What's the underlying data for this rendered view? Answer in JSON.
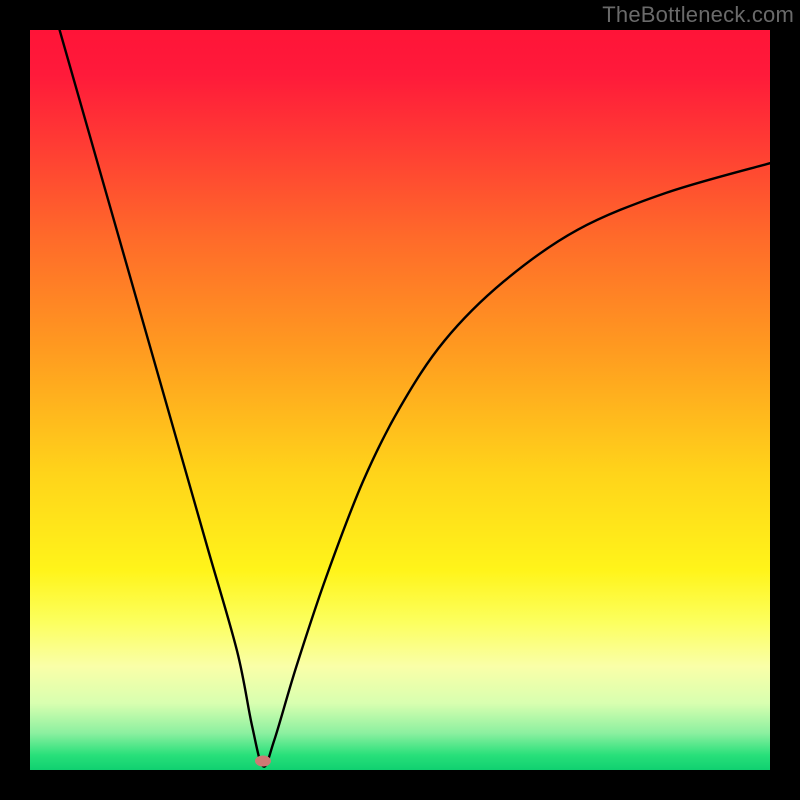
{
  "watermark": "TheBottleneck.com",
  "chart_data": {
    "type": "line",
    "title": "",
    "xlabel": "",
    "ylabel": "",
    "xlim": [
      0,
      100
    ],
    "ylim": [
      0,
      100
    ],
    "background": "rainbow-gradient-vertical",
    "series": [
      {
        "name": "bottleneck-curve",
        "x": [
          4,
          8,
          12,
          16,
          20,
          24,
          28,
          30,
          31.5,
          33,
          36,
          40,
          45,
          50,
          56,
          64,
          74,
          86,
          100
        ],
        "y": [
          100,
          86,
          72,
          58,
          44,
          30,
          16,
          6,
          0.5,
          4,
          14,
          26,
          39,
          49,
          58,
          66,
          73,
          78,
          82
        ]
      }
    ],
    "marker": {
      "name": "optimal-point",
      "x": 31.5,
      "y": 1.2,
      "color": "#cd7a74"
    },
    "frame": {
      "border_color": "#000000",
      "border_width": 30
    }
  }
}
